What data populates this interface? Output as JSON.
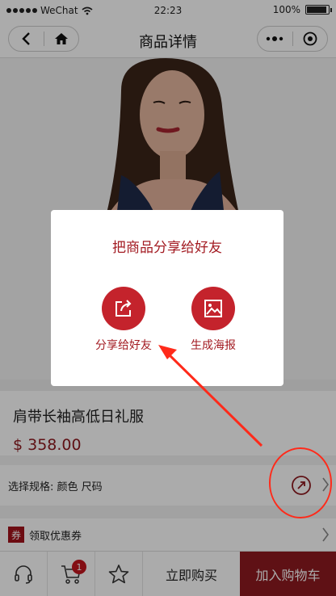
{
  "status_bar": {
    "carrier": "WeChat",
    "time": "22:23",
    "battery": "100%"
  },
  "nav": {
    "title": "商品详情"
  },
  "product": {
    "name": "肩带长袖高低日礼服",
    "price": "$ 358.00"
  },
  "spec": {
    "label": "选择规格: 颜色 尺码"
  },
  "coupon": {
    "badge": "券",
    "label": "领取优惠券"
  },
  "bottom": {
    "cart_count": "1",
    "buy_now": "立即购买",
    "add_to_cart": "加入购物车"
  },
  "share_modal": {
    "title": "把商品分享给好友",
    "options": [
      {
        "label": "分享给好友",
        "icon": "share-icon"
      },
      {
        "label": "生成海报",
        "icon": "image-icon"
      }
    ]
  },
  "colors": {
    "brand": "#8e1a20",
    "accent": "#c4232c",
    "annotation": "#ff2a1a"
  }
}
